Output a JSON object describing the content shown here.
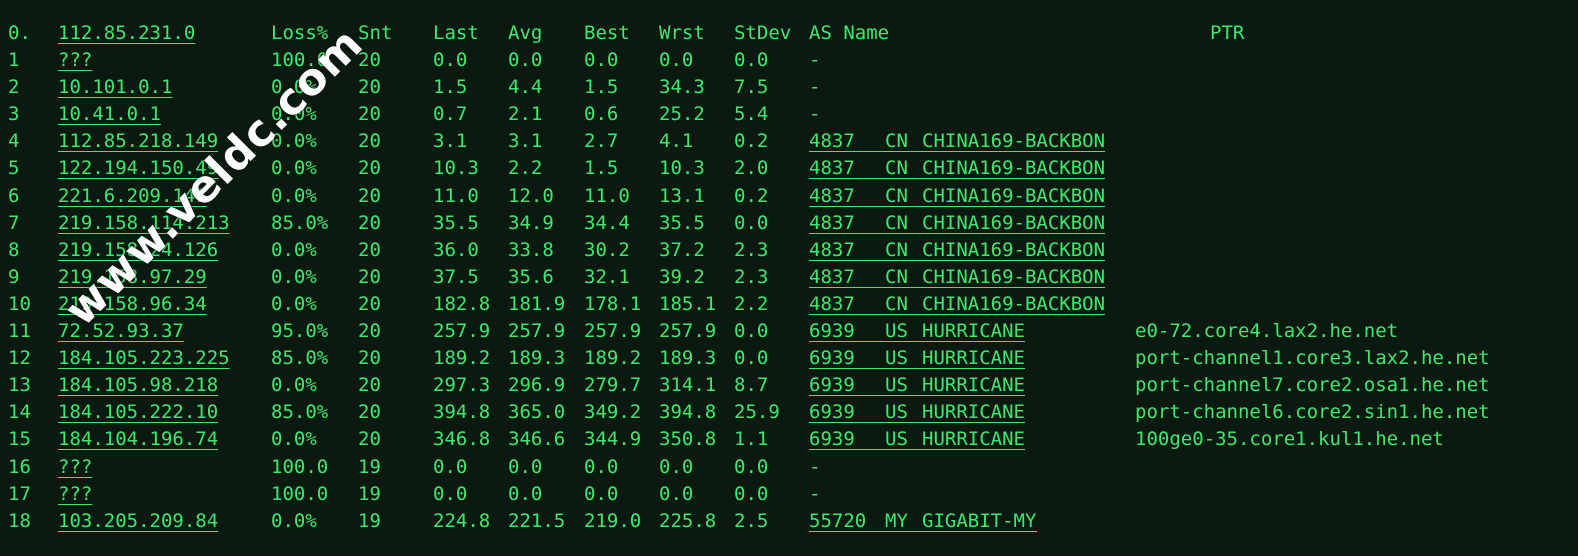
{
  "header": {
    "idx": "0.",
    "host": "112.85.231.0",
    "loss": "Loss%",
    "snt": "Snt",
    "last": "Last",
    "avg": "Avg",
    "best": "Best",
    "wrst": "Wrst",
    "stdev": "StDev",
    "as_name": "AS Name",
    "ptr": "PTR"
  },
  "hops": [
    {
      "idx": "1",
      "host": "???",
      "loss": "100.0",
      "snt": "20",
      "last": "0.0",
      "avg": "0.0",
      "best": "0.0",
      "wrst": "0.0",
      "stdev": "0.0",
      "asn": "-",
      "cc": "",
      "as_name": "",
      "ptr": ""
    },
    {
      "idx": "2",
      "host": "10.101.0.1",
      "loss": "0.0%",
      "snt": "20",
      "last": "1.5",
      "avg": "4.4",
      "best": "1.5",
      "wrst": "34.3",
      "stdev": "7.5",
      "asn": "-",
      "cc": "",
      "as_name": "",
      "ptr": ""
    },
    {
      "idx": "3",
      "host": "10.41.0.1",
      "loss": "0.0%",
      "snt": "20",
      "last": "0.7",
      "avg": "2.1",
      "best": "0.6",
      "wrst": "25.2",
      "stdev": "5.4",
      "asn": "-",
      "cc": "",
      "as_name": "",
      "ptr": ""
    },
    {
      "idx": "4",
      "host": "112.85.218.149",
      "loss": "0.0%",
      "snt": "20",
      "last": "3.1",
      "avg": "3.1",
      "best": "2.7",
      "wrst": "4.1",
      "stdev": "0.2",
      "asn": "4837",
      "cc": "CN",
      "as_name": "CHINA169-BACKBON",
      "ptr": ""
    },
    {
      "idx": "5",
      "host": "122.194.150.49",
      "loss": "0.0%",
      "snt": "20",
      "last": "10.3",
      "avg": "2.2",
      "best": "1.5",
      "wrst": "10.3",
      "stdev": "2.0",
      "asn": "4837",
      "cc": "CN",
      "as_name": "CHINA169-BACKBON",
      "ptr": ""
    },
    {
      "idx": "6",
      "host": "221.6.209.141",
      "loss": "0.0%",
      "snt": "20",
      "last": "11.0",
      "avg": "12.0",
      "best": "11.0",
      "wrst": "13.1",
      "stdev": "0.2",
      "asn": "4837",
      "cc": "CN",
      "as_name": "CHINA169-BACKBON",
      "ptr": ""
    },
    {
      "idx": "7",
      "host": "219.158.114.213",
      "loss": "85.0%",
      "snt": "20",
      "last": "35.5",
      "avg": "34.9",
      "best": "34.4",
      "wrst": "35.5",
      "stdev": "0.0",
      "asn": "4837",
      "cc": "CN",
      "as_name": "CHINA169-BACKBON",
      "ptr": ""
    },
    {
      "idx": "8",
      "host": "219.158.24.126",
      "loss": "0.0%",
      "snt": "20",
      "last": "36.0",
      "avg": "33.8",
      "best": "30.2",
      "wrst": "37.2",
      "stdev": "2.3",
      "asn": "4837",
      "cc": "CN",
      "as_name": "CHINA169-BACKBON",
      "ptr": ""
    },
    {
      "idx": "9",
      "host": "219.158.97.29",
      "loss": "0.0%",
      "snt": "20",
      "last": "37.5",
      "avg": "35.6",
      "best": "32.1",
      "wrst": "39.2",
      "stdev": "2.3",
      "asn": "4837",
      "cc": "CN",
      "as_name": "CHINA169-BACKBON",
      "ptr": ""
    },
    {
      "idx": "10",
      "host": "219.158.96.34",
      "loss": "0.0%",
      "snt": "20",
      "last": "182.8",
      "avg": "181.9",
      "best": "178.1",
      "wrst": "185.1",
      "stdev": "2.2",
      "asn": "4837",
      "cc": "CN",
      "as_name": "CHINA169-BACKBON",
      "ptr": ""
    },
    {
      "idx": "11",
      "host": "72.52.93.37",
      "loss": "95.0%",
      "snt": "20",
      "last": "257.9",
      "avg": "257.9",
      "best": "257.9",
      "wrst": "257.9",
      "stdev": "0.0",
      "asn": "6939",
      "cc": "US",
      "as_name": "HURRICANE",
      "ptr": "e0-72.core4.lax2.he.net"
    },
    {
      "idx": "12",
      "host": "184.105.223.225",
      "loss": "85.0%",
      "snt": "20",
      "last": "189.2",
      "avg": "189.3",
      "best": "189.2",
      "wrst": "189.3",
      "stdev": "0.0",
      "asn": "6939",
      "cc": "US",
      "as_name": "HURRICANE",
      "ptr": "port-channel1.core3.lax2.he.net"
    },
    {
      "idx": "13",
      "host": "184.105.98.218",
      "loss": "0.0%",
      "snt": "20",
      "last": "297.3",
      "avg": "296.9",
      "best": "279.7",
      "wrst": "314.1",
      "stdev": "8.7",
      "asn": "6939",
      "cc": "US",
      "as_name": "HURRICANE",
      "ptr": "port-channel7.core2.osa1.he.net"
    },
    {
      "idx": "14",
      "host": "184.105.222.10",
      "loss": "85.0%",
      "snt": "20",
      "last": "394.8",
      "avg": "365.0",
      "best": "349.2",
      "wrst": "394.8",
      "stdev": "25.9",
      "asn": "6939",
      "cc": "US",
      "as_name": "HURRICANE",
      "ptr": "port-channel6.core2.sin1.he.net"
    },
    {
      "idx": "15",
      "host": "184.104.196.74",
      "loss": "0.0%",
      "snt": "20",
      "last": "346.8",
      "avg": "346.6",
      "best": "344.9",
      "wrst": "350.8",
      "stdev": "1.1",
      "asn": "6939",
      "cc": "US",
      "as_name": "HURRICANE",
      "ptr": "100ge0-35.core1.kul1.he.net"
    },
    {
      "idx": "16",
      "host": "???",
      "loss": "100.0",
      "snt": "19",
      "last": "0.0",
      "avg": "0.0",
      "best": "0.0",
      "wrst": "0.0",
      "stdev": "0.0",
      "asn": "-",
      "cc": "",
      "as_name": "",
      "ptr": ""
    },
    {
      "idx": "17",
      "host": "???",
      "loss": "100.0",
      "snt": "19",
      "last": "0.0",
      "avg": "0.0",
      "best": "0.0",
      "wrst": "0.0",
      "stdev": "0.0",
      "asn": "-",
      "cc": "",
      "as_name": "",
      "ptr": ""
    },
    {
      "idx": "18",
      "host": "103.205.209.84",
      "loss": "0.0%",
      "snt": "19",
      "last": "224.8",
      "avg": "221.5",
      "best": "219.0",
      "wrst": "225.8",
      "stdev": "2.5",
      "asn": "55720",
      "cc": "MY",
      "as_name": "GIGABIT-MY",
      "ptr": ""
    }
  ],
  "watermark": "www.veldc.com",
  "colors": {
    "background": "#0b1a10",
    "text": "#3ee86a",
    "watermark": "#ffffff"
  }
}
